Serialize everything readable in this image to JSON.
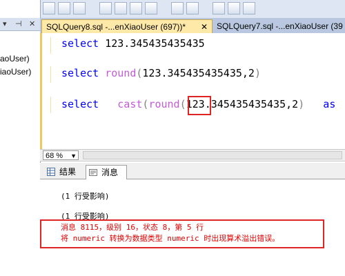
{
  "explorer": {
    "tree_items": [
      "aoUser)",
      "iaoUser)"
    ]
  },
  "tabs": {
    "active": "SQLQuery8.sql -...enXiaoUser (697))*",
    "active_close": "✕",
    "inactive": "SQLQuery7.sql -...enXiaoUser (39"
  },
  "editor": {
    "line1": {
      "kw": "select",
      "rest": " 123.345435435435"
    },
    "line2": {
      "kw": "select",
      "fn": " round",
      "open": "(",
      "num": "123.345435435435,2",
      "close": ")"
    },
    "line3": {
      "kw": "select",
      "fn": "   cast",
      "open": "(",
      "fn2": "round",
      "open2": "(",
      "num_highlight": "123.",
      "num_rest": "345435435435,2",
      "close": ")",
      "kw2": "   as"
    }
  },
  "zoom": {
    "value": "68 %"
  },
  "result_tabs": {
    "results": "结果",
    "messages": "消息"
  },
  "messages": {
    "line1": "(1 行受影响)",
    "line2": "(1 行受影响)",
    "error1": "消息 8115，级别 16，状态 8，第 5 行",
    "error2": "将 numeric 转换为数据类型 numeric 时出现算术溢出错误。"
  },
  "colors": {
    "keyword": "#0000ff",
    "function": "#c45ad8",
    "error": "#e00000",
    "highlight_box": "#e02424"
  }
}
